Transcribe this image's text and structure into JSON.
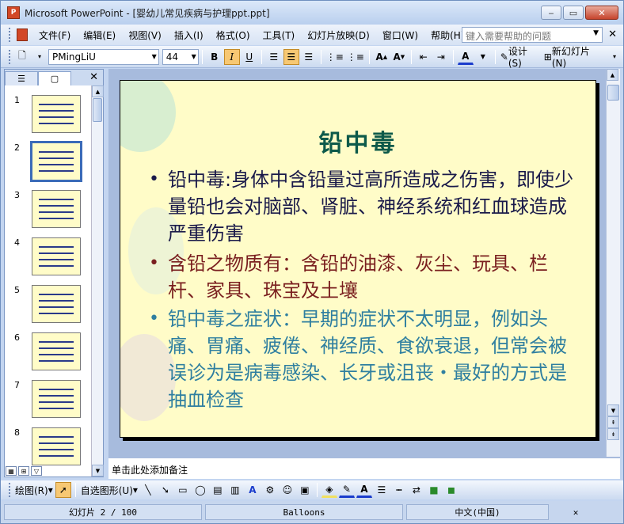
{
  "window": {
    "title": "Microsoft PowerPoint - [婴幼儿常见疾病与护理ppt.ppt]",
    "app_icon": "P"
  },
  "menu": {
    "items": [
      "文件(F)",
      "编辑(E)",
      "视图(V)",
      "插入(I)",
      "格式(O)",
      "工具(T)",
      "幻灯片放映(D)",
      "窗口(W)",
      "帮助(H)"
    ],
    "help_placeholder": "键入需要帮助的问题"
  },
  "toolbar": {
    "font_name": "PMingLiU",
    "font_size": "44",
    "bold": "B",
    "italic": "I",
    "underline": "U",
    "design_label": "设计(S)",
    "new_slide_label": "新幻灯片(N)"
  },
  "panel": {
    "thumb_numbers": [
      "1",
      "2",
      "3",
      "4",
      "5",
      "6",
      "7",
      "8"
    ],
    "selected": "2"
  },
  "slide": {
    "title": "铅中毒",
    "bullets": [
      {
        "text": "铅中毒:身体中含铅量过高所造成之伤害，即使少量铅也会对脑部、肾脏、神经系统和红血球造成严重伤害",
        "color": "#1a1a4a"
      },
      {
        "text": "含铅之物质有：含铅的油漆、灰尘、玩具、栏杆、家具、珠宝及土壤",
        "color": "#7a1f1f"
      },
      {
        "text": "铅中毒之症状：早期的症状不太明显，例如头痛、胃痛、疲倦、神经质、食欲衰退，但常会被误诊为是病毒感染、长牙或沮丧・最好的方式是抽血检查",
        "color": "#2f7fa0"
      }
    ],
    "bullet_char": "•"
  },
  "notes": {
    "placeholder": "单击此处添加备注"
  },
  "drawbar": {
    "draw_label": "绘图(R)",
    "autoshape_label": "自选图形(U)"
  },
  "status": {
    "slide_info": "幻灯片 2 / 100",
    "design": "Balloons",
    "language": "中文(中国)"
  }
}
